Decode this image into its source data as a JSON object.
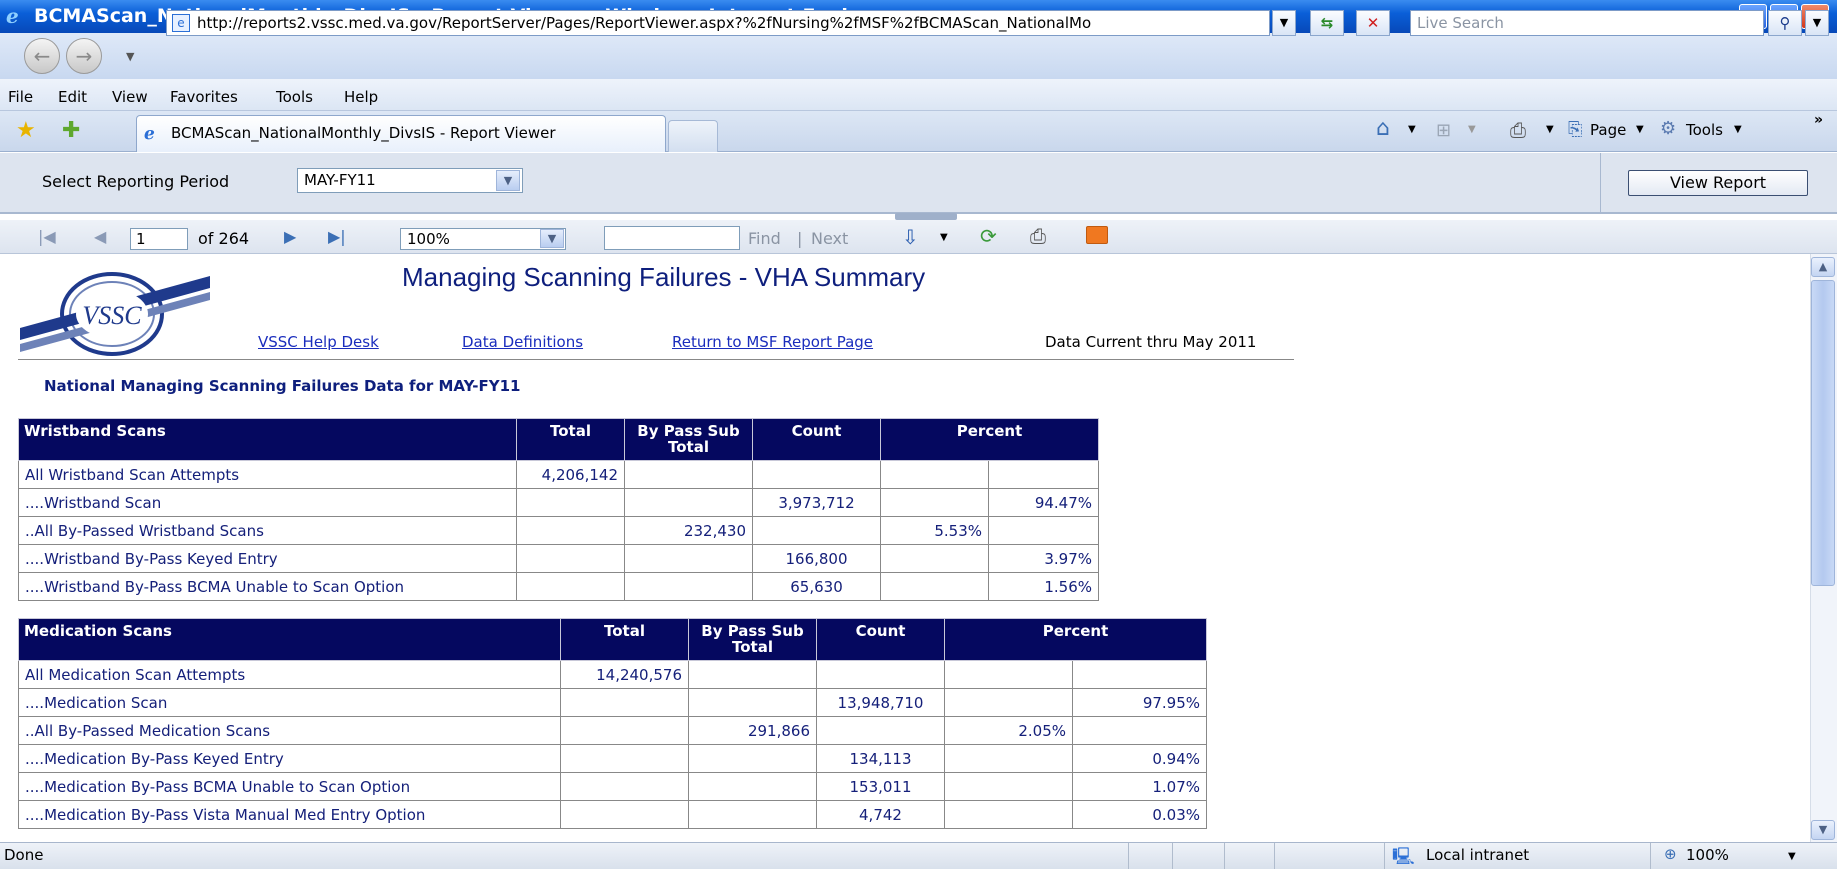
{
  "window": {
    "title": "BCMAScan_NationalMonthly_DivsIS - Report Viewer - Windows Internet Explorer",
    "controls": [
      "minimize-icon",
      "maximize-icon",
      "close-icon"
    ]
  },
  "address_bar": {
    "url": "http://reports2.vssc.med.va.gov/ReportServer/Pages/ReportViewer.aspx?%2fNursing%2fMSF%2fBCMAScan_NationalMo",
    "search_placeholder": "Live Search"
  },
  "menu": [
    "File",
    "Edit",
    "View",
    "Favorites",
    "Tools",
    "Help"
  ],
  "tab": {
    "label": "BCMAScan_NationalMonthly_DivsIS - Report Viewer"
  },
  "command_bar": {
    "page": "Page",
    "tools": "Tools"
  },
  "parameters": {
    "label": "Select Reporting Period",
    "selected_period": "MAY-FY11",
    "view_report_label": "View Report"
  },
  "toolbar": {
    "current_page": "1",
    "of_pages": "of 264",
    "zoom": "100%",
    "find_label": "Find",
    "separator": "|",
    "next_label": "Next"
  },
  "report": {
    "logo_text": "VSSC",
    "title": "Managing Scanning Failures - VHA Summary",
    "links": {
      "help_desk": "VSSC Help Desk",
      "data_definitions": "Data Definitions",
      "return": "Return to MSF Report Page"
    },
    "data_current": "Data Current thru May 2011",
    "subtitle": "National Managing Scanning Failures Data for MAY-FY11",
    "wristband_table": {
      "headers": [
        "Wristband Scans",
        "Total",
        "By Pass Sub Total",
        "Count",
        "Percent"
      ],
      "rows": [
        [
          "All Wristband Scan Attempts",
          "4,206,142",
          "",
          "",
          "",
          ""
        ],
        [
          "....Wristband Scan",
          "",
          "",
          "3,973,712",
          "",
          "94.47%"
        ],
        [
          "..All By-Passed Wristband Scans",
          "",
          "232,430",
          "",
          "5.53%",
          ""
        ],
        [
          "....Wristband By-Pass Keyed Entry",
          "",
          "",
          "166,800",
          "",
          "3.97%"
        ],
        [
          "....Wristband By-Pass BCMA Unable to Scan Option",
          "",
          "",
          "65,630",
          "",
          "1.56%"
        ]
      ]
    },
    "medication_table": {
      "headers": [
        "Medication Scans",
        "Total",
        "By Pass Sub Total",
        "Count",
        "Percent"
      ],
      "rows": [
        [
          "All Medication Scan Attempts",
          "14,240,576",
          "",
          "",
          "",
          ""
        ],
        [
          "....Medication Scan",
          "",
          "",
          "13,948,710",
          "",
          "97.95%"
        ],
        [
          "..All By-Passed Medication Scans",
          "",
          "291,866",
          "",
          "2.05%",
          ""
        ],
        [
          "....Medication By-Pass Keyed Entry",
          "",
          "",
          "134,113",
          "",
          "0.94%"
        ],
        [
          "....Medication By-Pass BCMA Unable to Scan Option",
          "",
          "",
          "153,011",
          "",
          "1.07%"
        ],
        [
          "....Medication By-Pass Vista Manual Med Entry Option",
          "",
          "",
          "4,742",
          "",
          "0.03%"
        ]
      ]
    }
  },
  "status_bar": {
    "status": "Done",
    "zone": "Local intranet",
    "zoom": "100%"
  },
  "colors": {
    "title_bar": "#0a5fd8",
    "table_header": "#05085f",
    "report_title": "#0e1f7d",
    "link": "#1a2dbd"
  }
}
